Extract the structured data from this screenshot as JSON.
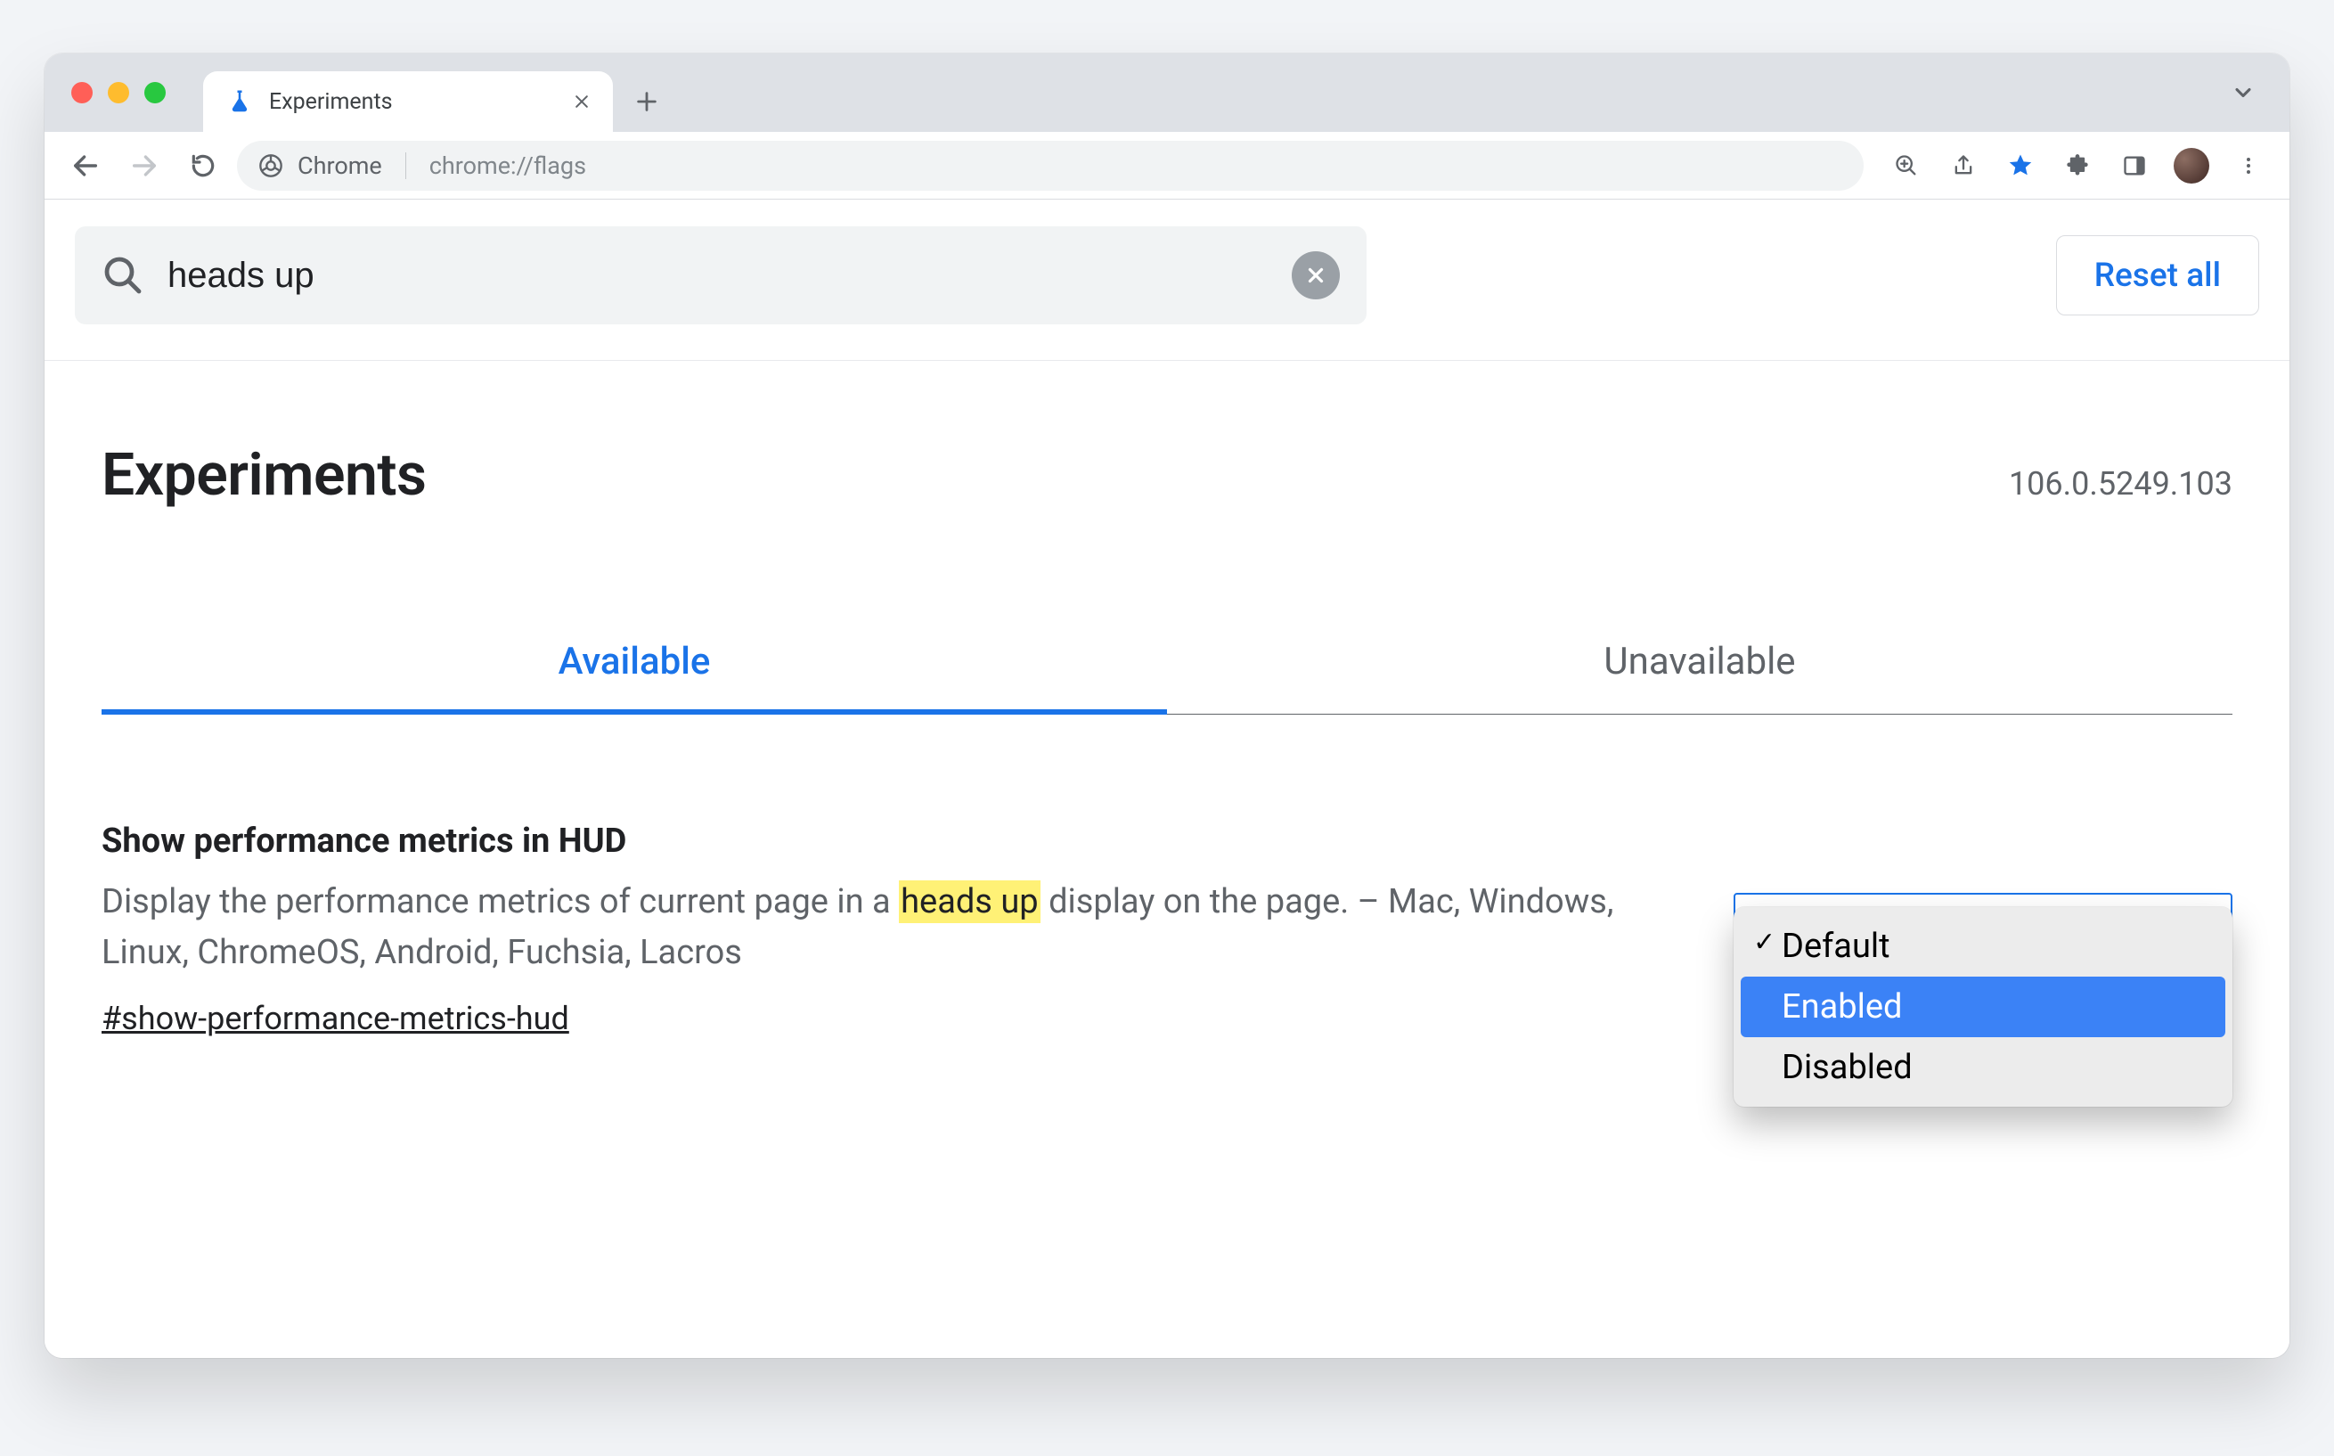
{
  "browser": {
    "tab_title": "Experiments",
    "omnibox_label": "Chrome",
    "omnibox_url": "chrome://flags"
  },
  "search": {
    "value": "heads up",
    "reset_all": "Reset all"
  },
  "page": {
    "title": "Experiments",
    "version": "106.0.5249.103"
  },
  "tabs": {
    "available": "Available",
    "unavailable": "Unavailable"
  },
  "flag": {
    "title": "Show performance metrics in HUD",
    "desc_before": "Display the performance metrics of current page in a ",
    "desc_highlight": "heads up",
    "desc_after": " display on the page. – Mac, Windows, Linux, ChromeOS, Android, Fuchsia, Lacros",
    "anchor": "#show-performance-metrics-hud",
    "options": {
      "default": "Default",
      "enabled": "Enabled",
      "disabled": "Disabled"
    }
  }
}
